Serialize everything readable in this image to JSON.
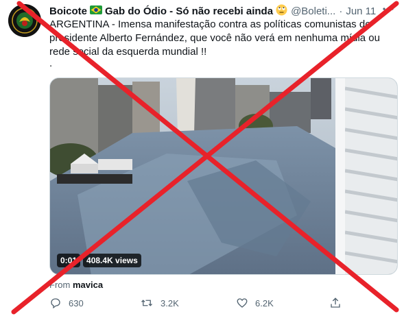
{
  "tweet": {
    "display_name": "Boicote",
    "display_name_rest": "Gab do Ódio - Só não recebi ainda",
    "handle": "@Boleti...",
    "separator": "·",
    "date": "Jun 11",
    "more_icon": "more-icon",
    "text": "ARGENTINA - Imensa manifestação contra as políticas comunistas do presidente Alberto Fernández, que você não verá em nenhuma mídia ou rede social da esquerda mundial !!",
    "text_trailing": "."
  },
  "video": {
    "timestamp": "0:01",
    "views": "408.4K views"
  },
  "source": {
    "prefix": "From",
    "name": "mavica"
  },
  "actions": {
    "reply_count": "630",
    "retweet_count": "3.2K",
    "like_count": "6.2K"
  },
  "colors": {
    "cross": "#e8222a",
    "muted": "#536471",
    "text": "#0f1419"
  }
}
